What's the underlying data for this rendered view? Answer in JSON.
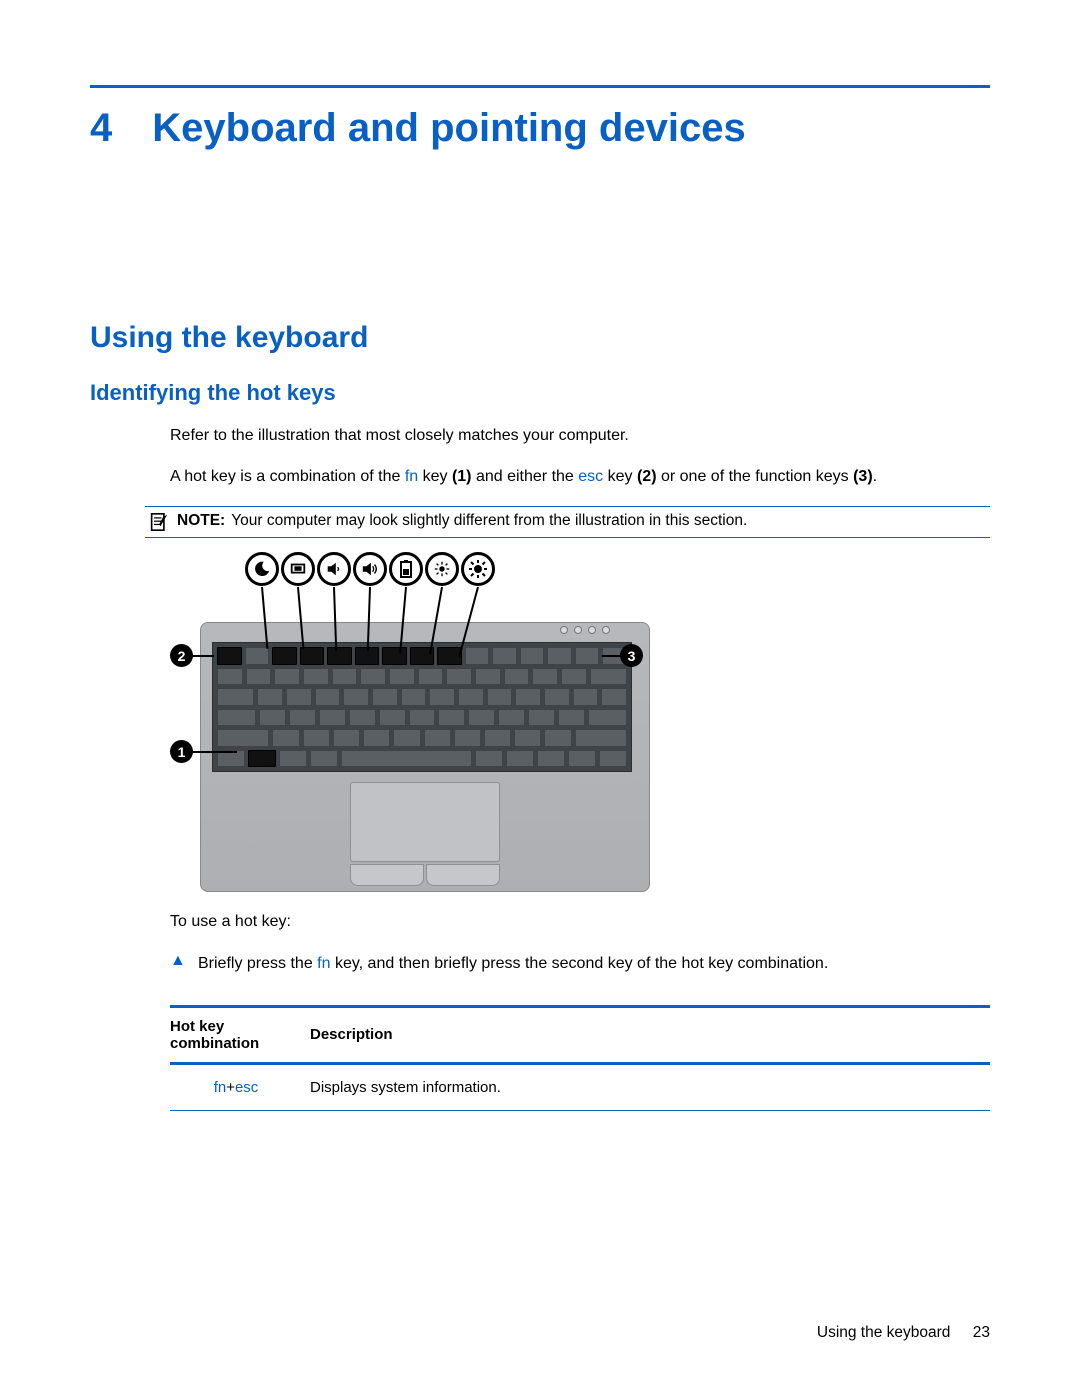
{
  "chapter": {
    "number": "4",
    "title": "Keyboard and pointing devices"
  },
  "section": {
    "title": "Using the keyboard"
  },
  "subsection": {
    "title": "Identifying the hot keys"
  },
  "para1": "Refer to the illustration that most closely matches your computer.",
  "para2": {
    "pre": "A hot key is a combination of the ",
    "fn": "fn",
    "mid1": " key ",
    "b1": "(1)",
    "mid2": " and either the ",
    "esc": "esc",
    "mid3": " key ",
    "b2": "(2)",
    "mid4": " or one of the function keys ",
    "b3": "(3)",
    "end": "."
  },
  "note": {
    "label": "NOTE:",
    "text": "Your computer may look slightly different from the illustration in this section."
  },
  "illustration": {
    "callouts": {
      "one": "1",
      "two": "2",
      "three": "3"
    },
    "icons": [
      "moon-icon",
      "display-toggle-icon",
      "volume-down-icon",
      "volume-up-icon",
      "battery-icon",
      "brightness-down-icon",
      "brightness-up-icon"
    ]
  },
  "para3": "To use a hot key:",
  "proc": {
    "marker": "▲",
    "pre": "Briefly press the ",
    "fn": "fn",
    "post": " key, and then briefly press the second key of the hot key combination."
  },
  "table": {
    "headers": {
      "col1_line1": "Hot key",
      "col1_line2": "combination",
      "col2": "Description"
    },
    "rows": [
      {
        "key1": "fn",
        "plus": "+",
        "key2": "esc",
        "desc": "Displays system information."
      }
    ]
  },
  "footer": {
    "section": "Using the keyboard",
    "page": "23"
  }
}
